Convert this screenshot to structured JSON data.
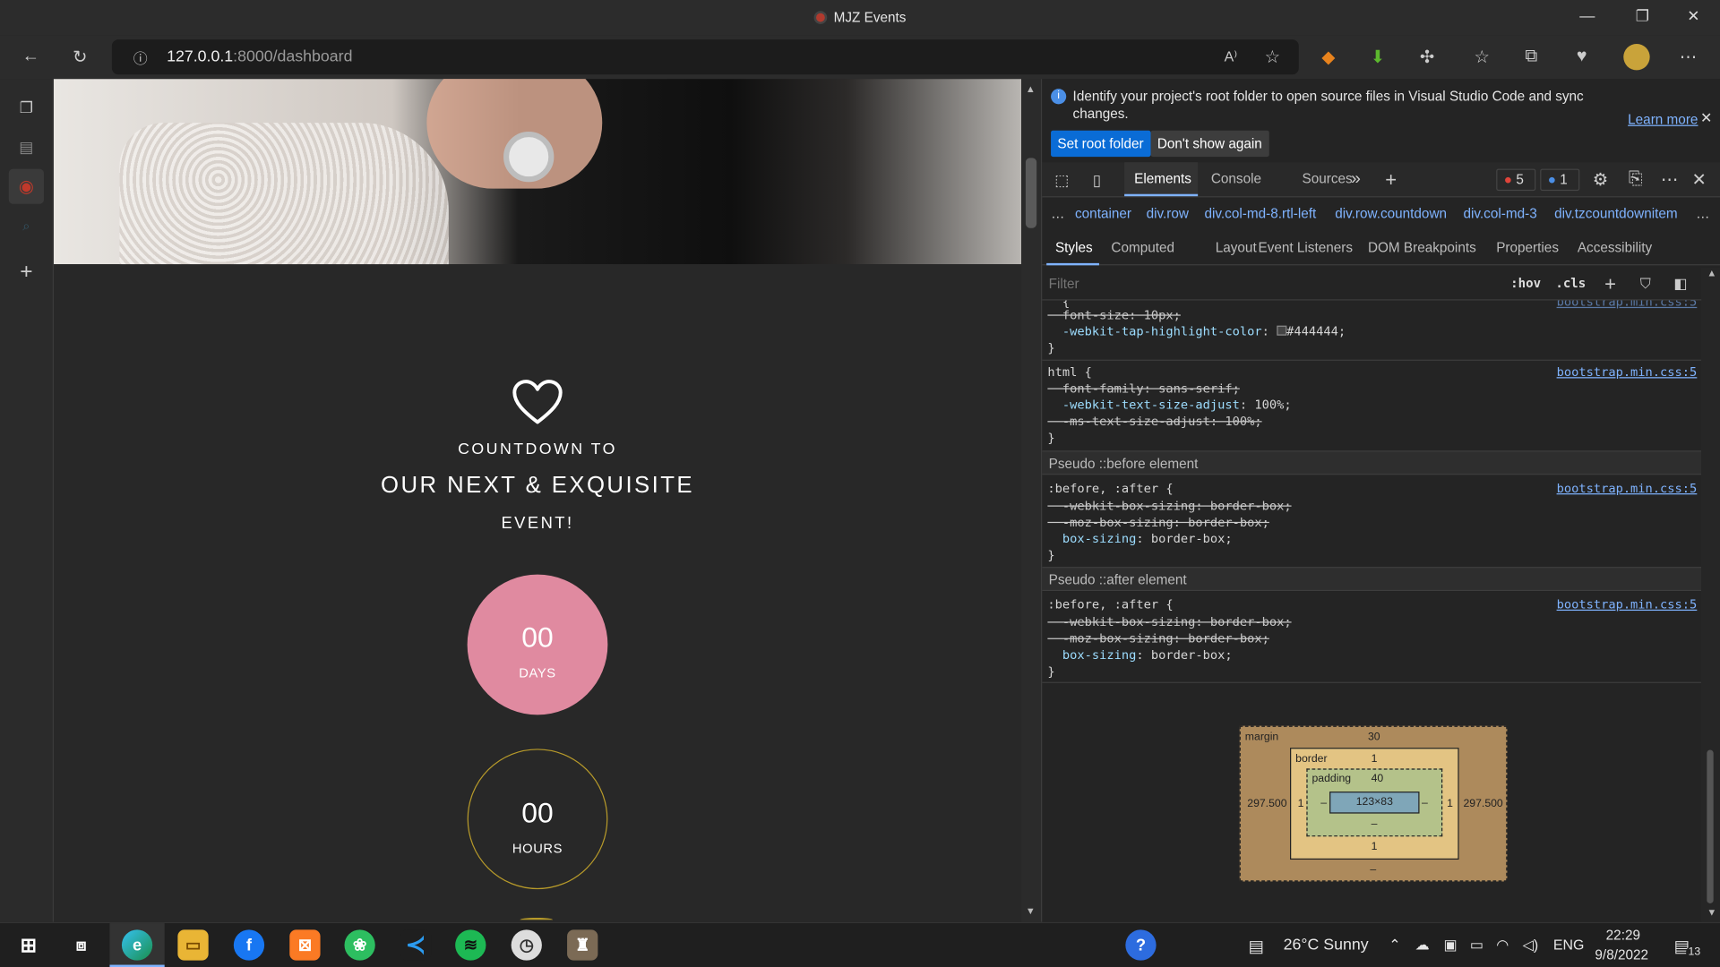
{
  "window": {
    "title": "MJZ Events"
  },
  "address_bar": {
    "url_host": "127.0.0.1",
    "url_rest": ":8000/dashboard"
  },
  "page": {
    "countdown_to": "COUNTDOWN TO",
    "headline": "OUR NEXT & EXQUISITE",
    "event": "EVENT!",
    "days_value": "00",
    "days_label": "DAYS",
    "hours_value": "00",
    "hours_label": "HOURS"
  },
  "devtools": {
    "infobar_msg": "Identify your project's root folder to open source files in Visual Studio Code and sync changes.",
    "learn_more": "Learn more",
    "set_root": "Set root folder",
    "dont_show": "Don't show again",
    "tabs": [
      "Elements",
      "Console",
      "Sources"
    ],
    "error_count": "5",
    "info_count": "1",
    "breadcrumbs": [
      "container",
      "div.row",
      "div.col-md-8.rtl-left",
      "div.row.countdown",
      "div.col-md-3",
      "div.tzcountdownitem"
    ],
    "subtabs": [
      "Styles",
      "Computed",
      "Layout",
      "Event Listeners",
      "DOM Breakpoints",
      "Properties",
      "Accessibility"
    ],
    "filter_placeholder": "Filter",
    "hov": ":hov",
    "cls": ".cls",
    "pseudo_before": "Pseudo ::before element",
    "pseudo_after": "Pseudo ::after element",
    "source_link": "bootstrap.min.css:5",
    "boxmodel": {
      "margin_label": "margin",
      "margin_top": "30",
      "margin_bottom": "–",
      "margin_left": "297.500",
      "margin_right": "297.500",
      "border_label": "border",
      "border_top": "1",
      "border_bottom": "1",
      "border_left": "1",
      "border_right": "1",
      "padding_label": "padding",
      "padding_top": "40",
      "padding_bottom": "–",
      "padding_left": "–",
      "padding_right": "–",
      "content": "123×83"
    }
  },
  "taskbar": {
    "weather": "26°C  Sunny",
    "lang": "ENG",
    "time": "22:29",
    "date": "9/8/2022",
    "notif_count": "13"
  },
  "colors": {
    "days_circle": "#e08aa0",
    "hours_ring": "#b79a2a",
    "link": "#7fb3ff",
    "primary_btn": "#0a6cd6"
  }
}
